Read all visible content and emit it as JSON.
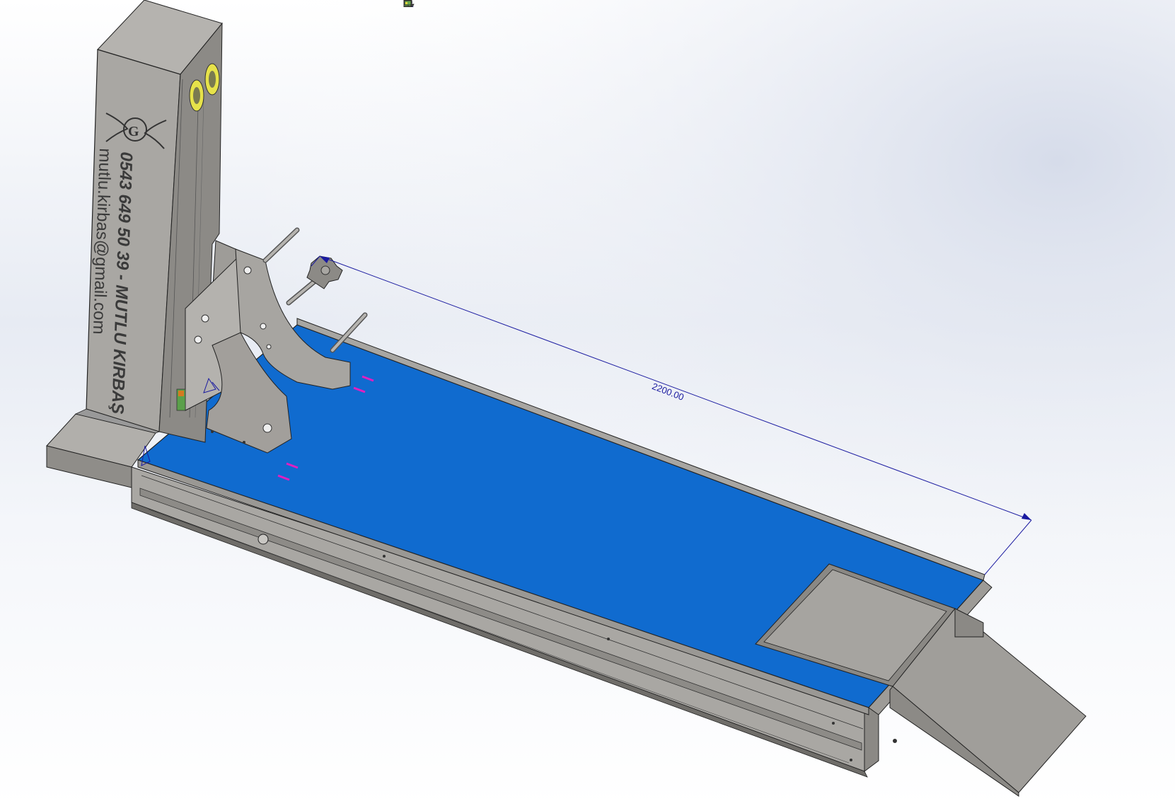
{
  "viewport": {
    "background_top": "#ffffff",
    "background_mid": "#dfe4ef",
    "background_bottom": "#ffffff"
  },
  "heads_up_toolbar": {
    "icons": [
      "zoom-to-fit-icon",
      "zoom-to-area-icon",
      "previous-view-icon",
      "section-view-icon",
      "view-orientation-icon",
      "display-style-icon",
      "hide-show-items-icon",
      "edit-appearance-icon",
      "apply-scene-icon",
      "view-settings-icon"
    ]
  },
  "model": {
    "engraving_phone": "0543 649 50 39 - MUTLU KIRBAŞ",
    "engraving_email": "mutlu.kirbas@gmail.com",
    "colors": {
      "metal": "#a8a6a2",
      "metal_dark": "#7d7b77",
      "mat_blue": "#136ccd",
      "dimension_blue": "#1a1aa0",
      "yellow_pulley": "#e6e24a",
      "magenta_marker": "#e020c0"
    }
  },
  "dimension": {
    "value": "2200.00"
  }
}
